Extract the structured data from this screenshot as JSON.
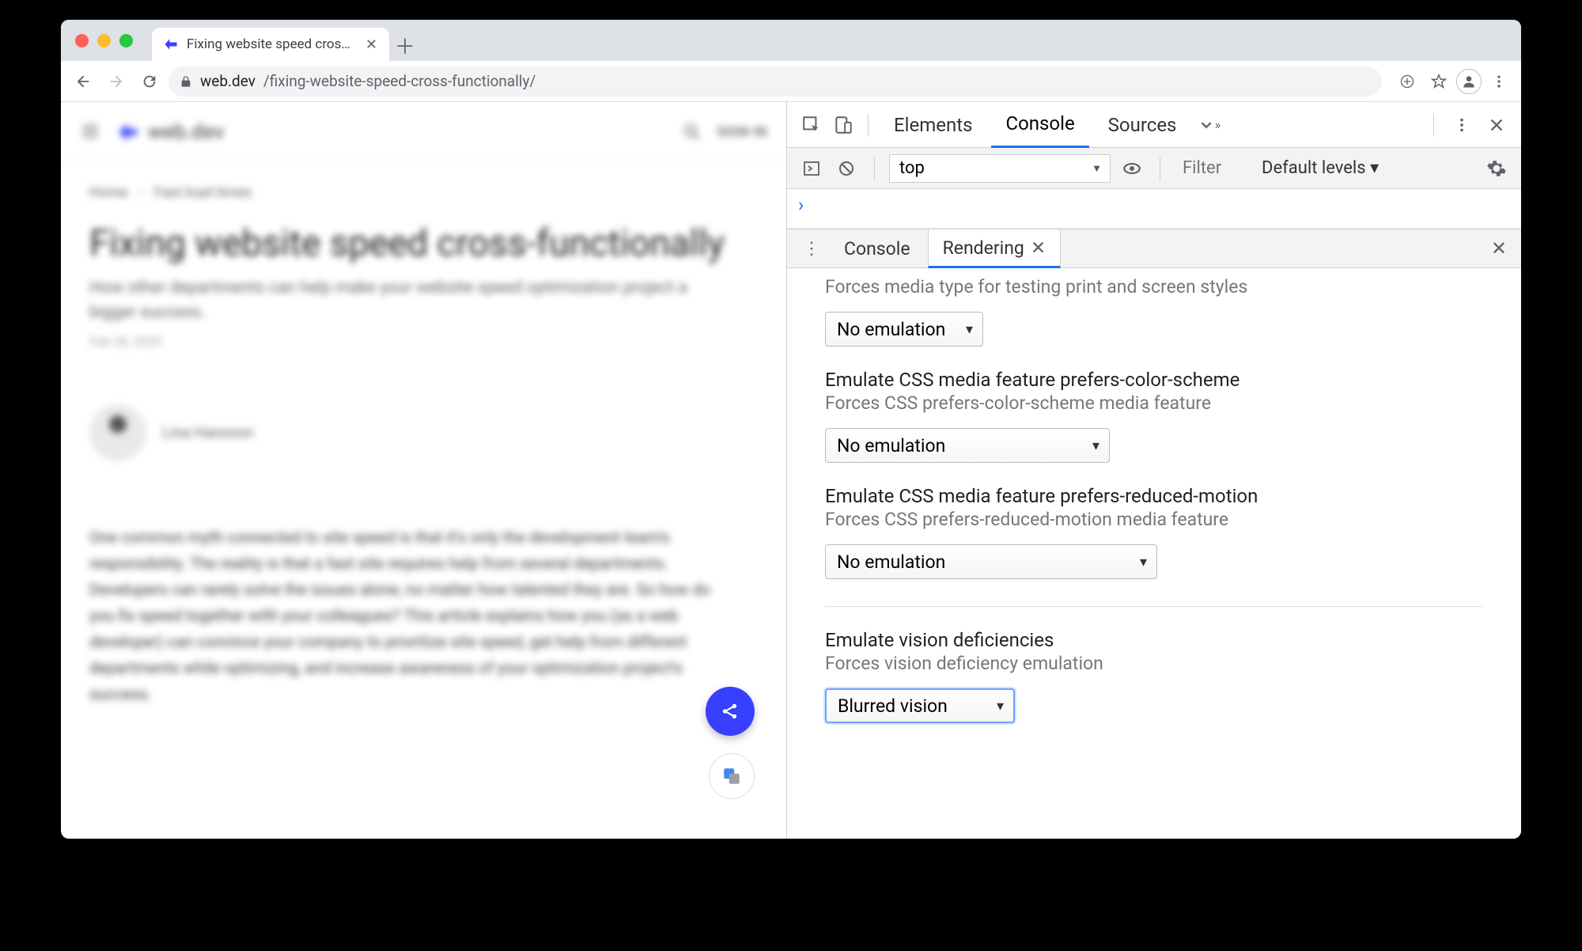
{
  "browser": {
    "tab_title": "Fixing website speed cross-fun…",
    "url_host": "web.dev",
    "url_path": "/fixing-website-speed-cross-functionally/"
  },
  "page": {
    "brand": "web.dev",
    "signin": "SIGN IN",
    "crumb1": "Home",
    "crumb2": "Fast load times",
    "h1": "Fixing website speed cross-functionally",
    "subtitle": "How other departments can help make your website speed optimization project a bigger success.",
    "date": "Feb 28, 2020",
    "author": "Lina Hansson",
    "body_para": "One common myth connected to site speed is that it's only the development team's responsibility. The reality is that a fast site requires help from several departments. Developers can rarely solve the issues alone, no matter how talented they are. So how do you fix speed together with your colleagues? This article explains how you (as a web developer) can convince your company to prioritize site speed, get help from different departments while optimizing, and increase awareness of your optimization project's success."
  },
  "devtools": {
    "tabs": {
      "elements": "Elements",
      "console": "Console",
      "sources": "Sources"
    },
    "context": "top",
    "filter_placeholder": "Filter",
    "levels": "Default levels ▾",
    "console_prompt": "›",
    "drawer": {
      "console": "Console",
      "rendering": "Rendering"
    },
    "rendering": {
      "media_desc": "Forces media type for testing print and screen styles",
      "media_select": "No emulation",
      "pcs_title": "Emulate CSS media feature prefers-color-scheme",
      "pcs_desc": "Forces CSS prefers-color-scheme media feature",
      "pcs_select": "No emulation",
      "prm_title": "Emulate CSS media feature prefers-reduced-motion",
      "prm_desc": "Forces CSS prefers-reduced-motion media feature",
      "prm_select": "No emulation",
      "vis_title": "Emulate vision deficiencies",
      "vis_desc": "Forces vision deficiency emulation",
      "vis_select": "Blurred vision"
    }
  }
}
